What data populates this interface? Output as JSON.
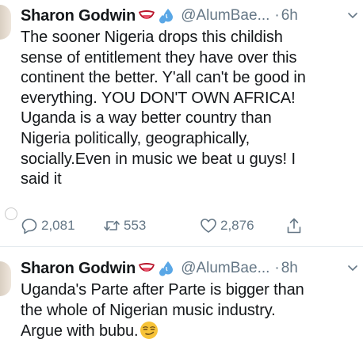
{
  "tweets": [
    {
      "display_name": "Sharon Godwin",
      "handle": "@AlumBae...",
      "separator": "·",
      "time": "6h",
      "lines": [
        "The sooner Nigeria drops this childish",
        "sense of entitlement they have over this",
        "continent the better. Y'all can't be good in",
        "everything. YOU DON'T OWN AFRICA!",
        "Uganda is a way better country than",
        "Nigeria politically, geographically,",
        "socially.Even in music we beat u guys! I",
        "said it"
      ],
      "actions": {
        "replies": "2,081",
        "retweets": "553",
        "likes": "2,876"
      }
    },
    {
      "display_name": "Sharon Godwin",
      "handle": "@AlumBae...",
      "separator": "·",
      "time": "8h",
      "lines": [
        "Uganda's Parte after Parte is bigger than",
        "the whole of Nigerian music industry.",
        "Argue with bubu."
      ]
    }
  ],
  "icons": {
    "name_emoji_1": "tongue-mouth-emoji",
    "name_emoji_2": "sweat-droplets-emoji",
    "text_emoji": "smirking-face-emoji",
    "reply": "reply-icon",
    "retweet": "retweet-icon",
    "like": "heart-icon",
    "share": "share-icon",
    "menu": "chevron-down-icon"
  },
  "colors": {
    "text": "#14171a",
    "meta": "#657786",
    "divider": "#e1e8ed",
    "background": "#ffffff"
  }
}
